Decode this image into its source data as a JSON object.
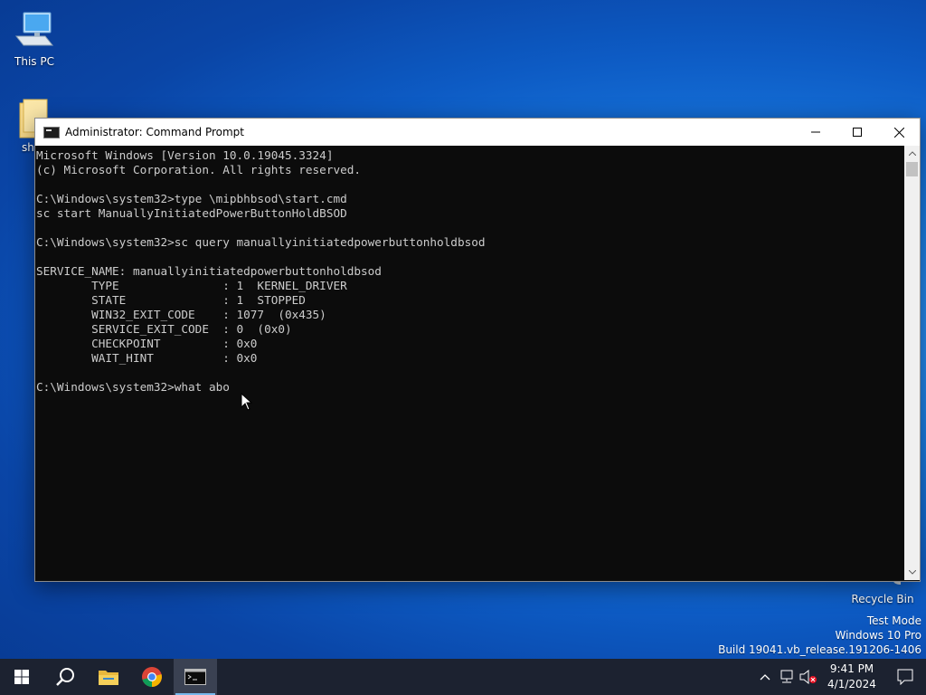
{
  "desktop": {
    "icons": [
      {
        "label": "This PC",
        "icon": "this-pc-icon"
      },
      {
        "label": "sh",
        "icon": "folder-icon"
      },
      {
        "label": "Recycle Bin",
        "icon": "recycle-bin-icon"
      }
    ],
    "watermark": {
      "line1": "Test Mode",
      "line2": "Windows 10 Pro",
      "line3": "Build 19041.vb_release.191206-1406"
    }
  },
  "window": {
    "title": "Administrator: Command Prompt",
    "icon": "cmd-icon",
    "controls": {
      "minimize": "minimize-icon",
      "maximize": "maximize-icon",
      "close": "close-icon"
    },
    "console_text": "Microsoft Windows [Version 10.0.19045.3324]\n(c) Microsoft Corporation. All rights reserved.\n\nC:\\Windows\\system32>type \\mipbhbsod\\start.cmd\nsc start ManuallyInitiatedPowerButtonHoldBSOD\n\nC:\\Windows\\system32>sc query manuallyinitiatedpowerbuttonholdbsod\n\nSERVICE_NAME: manuallyinitiatedpowerbuttonholdbsod\n        TYPE               : 1  KERNEL_DRIVER\n        STATE              : 1  STOPPED\n        WIN32_EXIT_CODE    : 1077  (0x435)\n        SERVICE_EXIT_CODE  : 0  (0x0)\n        CHECKPOINT         : 0x0\n        WAIT_HINT          : 0x0\n\nC:\\Windows\\system32>what abo"
  },
  "taskbar": {
    "apps": [
      "start-icon",
      "search-icon",
      "file-explorer-icon",
      "chrome-icon",
      "command-prompt-icon"
    ],
    "active_app": "command-prompt-icon",
    "tray": [
      "chevron-up-icon",
      "network-icon",
      "volume-muted-icon"
    ],
    "time": "9:41 PM",
    "date": "4/1/2024"
  },
  "colors": {
    "console_bg": "#0c0c0c",
    "console_fg": "#cccccc",
    "taskbar_bg": "#1c2230",
    "desktop_blue": "#0d5bc4"
  }
}
